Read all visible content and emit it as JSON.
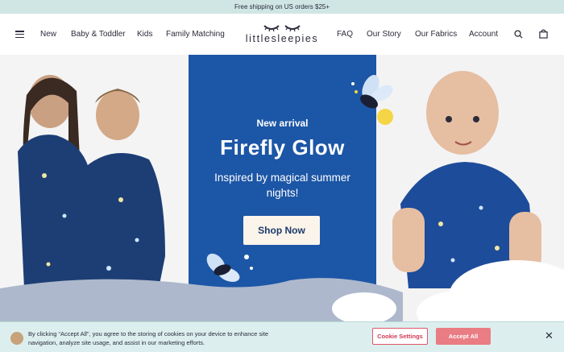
{
  "promo": {
    "text": "Free shipping on US orders $25+"
  },
  "nav": {
    "left_links": [
      "New",
      "Baby & Toddler",
      "Kids",
      "Family Matching"
    ],
    "right_links": [
      "FAQ",
      "Our Story",
      "Our Fabrics",
      "Account"
    ],
    "logo_text": "littlesleepies"
  },
  "hero": {
    "kicker": "New arrival",
    "headline": "Firefly Glow",
    "subline": "Inspired by magical summer nights!",
    "cta_label": "Shop Now"
  },
  "cookie": {
    "text": "By clicking “Accept All”, you agree to the storing of cookies on your device to enhance site navigation, analyze site usage, and assist in our marketing efforts.",
    "settings_label": "Cookie Settings",
    "accept_label": "Accept All",
    "close_label": "✕"
  },
  "colors": {
    "promo_bg": "#cfe6e4",
    "hero_blue": "#1c56a6",
    "accept_pink": "#ea7c84",
    "settings_red": "#d23a52"
  },
  "icons": [
    "menu-icon",
    "search-icon",
    "shopping-bag-icon",
    "firefly-icon",
    "close-icon"
  ]
}
